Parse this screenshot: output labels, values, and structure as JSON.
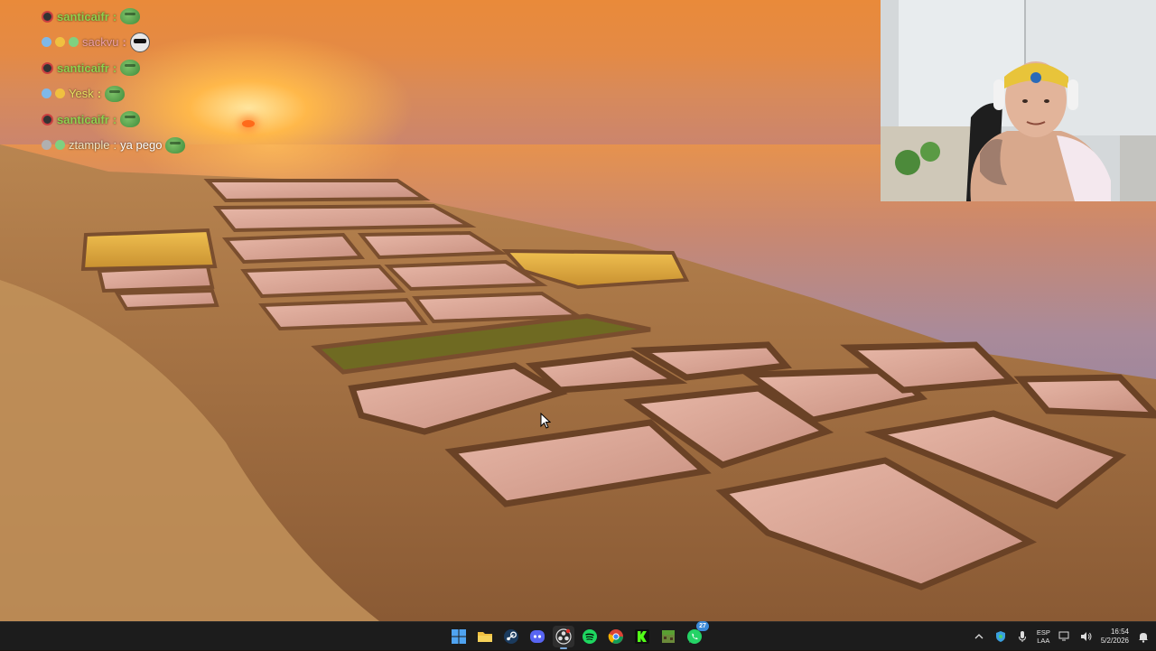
{
  "chat": {
    "messages": [
      {
        "user": "santicaifr",
        "text": ""
      },
      {
        "user": "sackvu",
        "text": ""
      },
      {
        "user": "santicaifr",
        "text": ""
      },
      {
        "user": "Yesk",
        "text": ""
      },
      {
        "user": "santicaifr",
        "text": ""
      },
      {
        "user": "ztample",
        "text": "ya pego"
      }
    ],
    "separator": ":"
  },
  "taskbar": {
    "apps": [
      {
        "name": "start",
        "icon": "windows-icon"
      },
      {
        "name": "file-explorer",
        "icon": "folder-icon"
      },
      {
        "name": "steam",
        "icon": "steam-icon"
      },
      {
        "name": "discord",
        "icon": "discord-icon"
      },
      {
        "name": "obs",
        "icon": "obs-icon"
      },
      {
        "name": "spotify",
        "icon": "spotify-icon"
      },
      {
        "name": "chrome",
        "icon": "chrome-icon"
      },
      {
        "name": "kick",
        "icon": "kick-icon"
      },
      {
        "name": "minecraft",
        "icon": "minecraft-icon"
      },
      {
        "name": "whatsapp",
        "icon": "whatsapp-icon",
        "badge": "27"
      }
    ],
    "tray": {
      "language_top": "ESP",
      "language_bottom": "LAA",
      "time": "16:54",
      "date": "5/2/2026"
    }
  },
  "colors": {
    "taskbar_bg": "#1c1c1c",
    "chat_username": "#8fd14f",
    "accent_blue": "#3b8ad8"
  }
}
